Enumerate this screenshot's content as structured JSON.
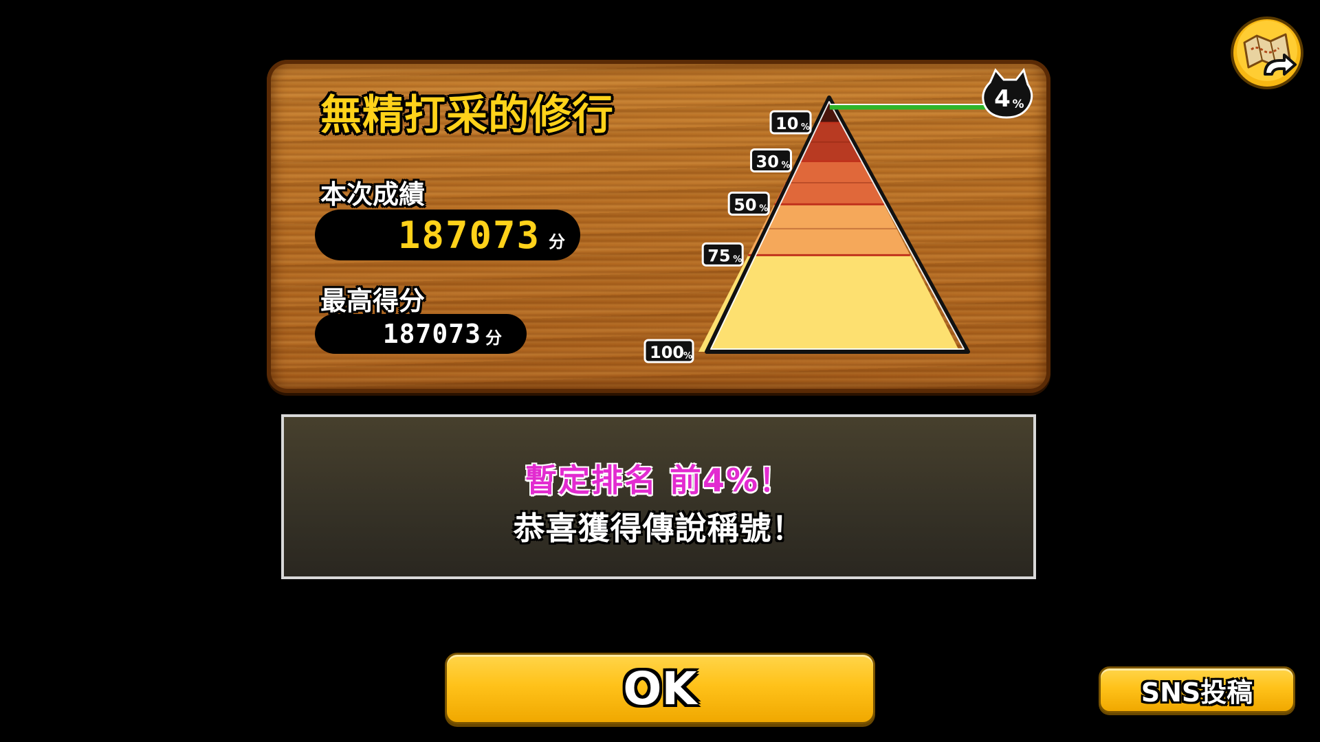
{
  "panel": {
    "title": "無精打采的修行",
    "current_label": "本次成績",
    "current_score": "187073",
    "current_unit": "分",
    "best_label": "最高得分",
    "best_score": "187073",
    "best_unit": "分"
  },
  "ranking_pyramid": {
    "tiers": [
      {
        "label_num": "10",
        "label_unit": "%",
        "value": 10,
        "color": "#8a2a1a"
      },
      {
        "label_num": "30",
        "label_unit": "%",
        "value": 30,
        "color": "#b83a22"
      },
      {
        "label_num": "50",
        "label_unit": "%",
        "value": 50,
        "color": "#e0683a"
      },
      {
        "label_num": "75",
        "label_unit": "%",
        "value": 75,
        "color": "#f5a85a"
      },
      {
        "label_num": "100",
        "label_unit": "%",
        "value": 100,
        "color": "#fde070"
      }
    ],
    "top_band_color": "#4a140c",
    "player_marker": {
      "label_num": "4",
      "label_unit": "%",
      "value": 4
    },
    "marker_line_color": "#2fb52a"
  },
  "message": {
    "rank_text": "暫定排名 前4%！",
    "congrats_text": "恭喜獲得傳說稱號！"
  },
  "buttons": {
    "ok_label": "OK",
    "sns_label": "SNS投稿"
  },
  "colors": {
    "title_yellow": "#ffd21a",
    "rank_magenta": "#e22bd0",
    "button_yellow": "#ffc21a"
  },
  "icons": {
    "map_back": "map-back-icon",
    "cat_marker": "cat-head-icon"
  }
}
